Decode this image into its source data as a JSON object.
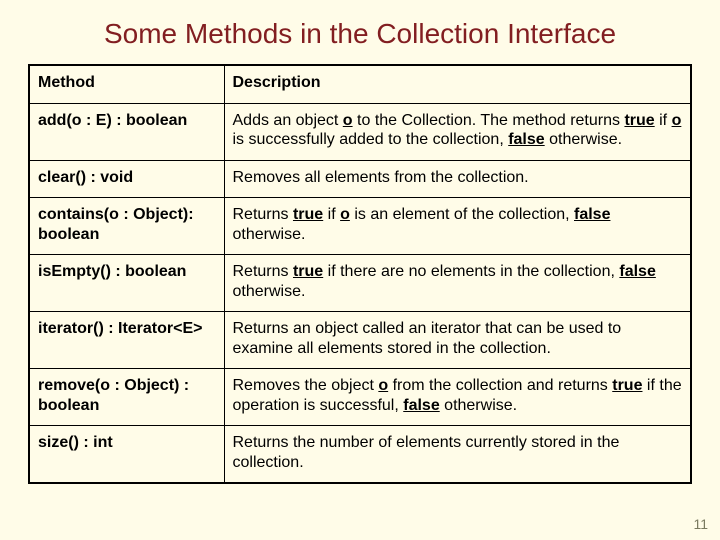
{
  "title": "Some Methods in the Collection Interface",
  "headers": {
    "method": "Method",
    "description": "Description"
  },
  "rows": [
    {
      "method": "add(o : E) : boolean",
      "desc": "Adds an object <span class=\"b u\">o</span> to the Collection. The method returns <span class=\"b u\">true</span> if <span class=\"b u\">o</span> is successfully added to the collection, <span class=\"b u\">false</span> otherwise."
    },
    {
      "method": "clear() : void",
      "desc": "Removes all elements from the collection."
    },
    {
      "method": "contains(o : Object): boolean",
      "desc": "Returns <span class=\"b u\">true</span> if <span class=\"b u\">o</span> is an element of the collection, <span class=\"b u\">false</span> otherwise."
    },
    {
      "method": "isEmpty() : boolean",
      "desc": "Returns <span class=\"b u\">true</span> if there are no elements in the collection, <span class=\"b u\">false</span> otherwise."
    },
    {
      "method": "iterator() : Iterator<E>",
      "desc": "Returns an object called an iterator that can be used to examine all elements stored in the collection."
    },
    {
      "method": "remove(o : Object) : boolean",
      "desc": "Removes the object <span class=\"b u\">o</span> from the collection and returns <span class=\"b u\">true</span> if the operation is successful, <span class=\"b u\">false</span> otherwise."
    },
    {
      "method": "size() : int",
      "desc": "Returns the number of elements currently stored in the collection."
    }
  ],
  "page_number": "11"
}
